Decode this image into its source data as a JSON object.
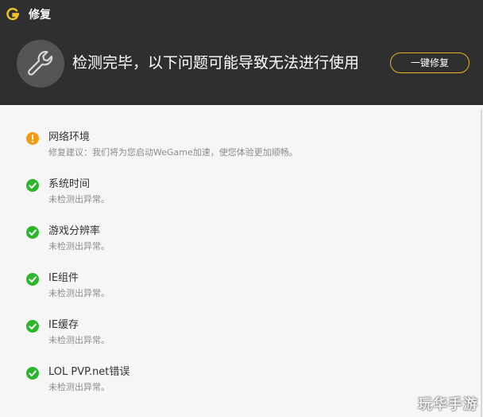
{
  "window": {
    "title": "修复"
  },
  "header": {
    "message": "检测完毕，以下问题可能导致无法进行使用",
    "fix_button_label": "一键修复"
  },
  "items": [
    {
      "name": "网络环境",
      "desc": "修复建议：我们将为您启动WeGame加速，使您体验更加顺畅。",
      "status": "warning"
    },
    {
      "name": "系统时间",
      "desc": "未检测出异常。",
      "status": "ok"
    },
    {
      "name": "游戏分辨率",
      "desc": "未检测出异常。",
      "status": "ok"
    },
    {
      "name": "IE组件",
      "desc": "未检测出异常。",
      "status": "ok"
    },
    {
      "name": "IE缓存",
      "desc": "未检测出异常。",
      "status": "ok"
    },
    {
      "name": "LOL PVP.net错误",
      "desc": "未检测出异常。",
      "status": "ok"
    }
  ],
  "colors": {
    "header_bg": "#2f2f2f",
    "accent": "#e8b21c",
    "ok": "#2bb52b",
    "warning": "#f39c12"
  },
  "icons": {
    "logo": "wegame-logo-icon",
    "header": "wrench-icon",
    "ok": "check-circle-icon",
    "warning": "exclamation-circle-icon"
  },
  "watermark": "玩华手游"
}
